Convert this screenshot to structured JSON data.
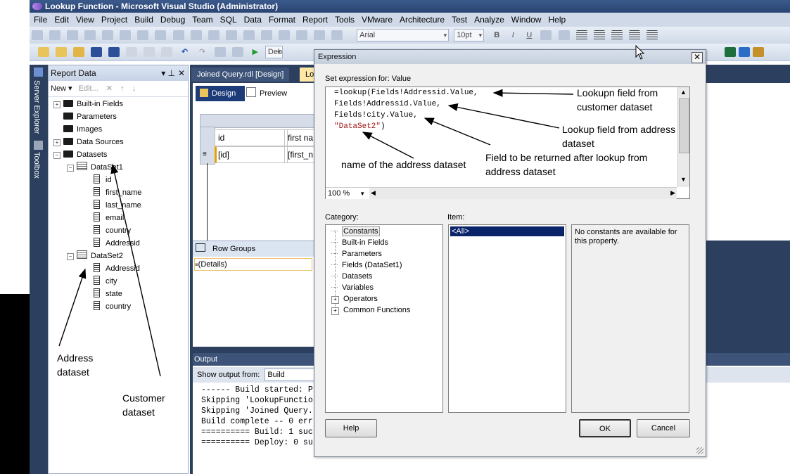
{
  "window": {
    "title": "Lookup Function - Microsoft Visual Studio (Administrator)"
  },
  "menu": [
    "File",
    "Edit",
    "View",
    "Project",
    "Build",
    "Debug",
    "Team",
    "SQL",
    "Data",
    "Format",
    "Report",
    "Tools",
    "VMware",
    "Architecture",
    "Test",
    "Analyze",
    "Window",
    "Help"
  ],
  "toolbar": {
    "font_name": "Arial",
    "font_size": "10pt",
    "config": "Deb"
  },
  "side_tabs": {
    "server_explorer": "Server Explorer",
    "toolbox": "Toolbox"
  },
  "report_data": {
    "title": "Report Data",
    "pin_glyph": "▾ ⊥",
    "close_glyph": "✕",
    "new_label": "New ▾",
    "edit_label": "Edit...",
    "tree": {
      "builtin": "Built-in Fields",
      "parameters": "Parameters",
      "images": "Images",
      "data_sources": "Data Sources",
      "datasets": "Datasets",
      "dataset1": "DataSet1",
      "dataset1_fields": [
        "id",
        "first_name",
        "last_name",
        "email",
        "country",
        "Addressid"
      ],
      "dataset2": "DataSet2",
      "dataset2_fields": [
        "Addressid",
        "city",
        "state",
        "country"
      ]
    }
  },
  "doc_tabs": {
    "tab1": "Joined Query.rdl [Design]",
    "tab2": "Loo"
  },
  "design": {
    "design_tab": "Design",
    "preview_tab": "Preview",
    "cell_header_1": "id",
    "cell_header_2": "first na",
    "cell_data_1": "[id]",
    "cell_data_2": "[first_n"
  },
  "row_groups": {
    "title": "Row Groups",
    "details": "(Details)"
  },
  "output": {
    "title": "Output",
    "show_from_label": "Show output from:",
    "show_from_value": "Build",
    "lines": [
      "------ Build started: P",
      "Skipping 'LookupFunctio",
      "Skipping 'Joined Query.",
      "Build complete -- 0 err",
      "========== Build: 1 suc",
      "========== Deploy: 0 su"
    ]
  },
  "dialog": {
    "title": "Expression",
    "set_for": "Set expression for: Value",
    "expression_lines": [
      "=lookup(Fields!Addressid.Value,",
      "Fields!Addressid.Value,",
      "Fields!city.Value,"
    ],
    "expression_string": "\"DataSet2\"",
    "expression_tail": ")",
    "zoom": "100 %",
    "category_label": "Category:",
    "categories": [
      "Constants",
      "Built-in Fields",
      "Parameters",
      "Fields (DataSet1)",
      "Datasets",
      "Variables",
      "Operators",
      "Common Functions"
    ],
    "item_label": "Item:",
    "item_selected": "<All>",
    "description": "No constants are available for this property.",
    "help_button": "Help",
    "ok_button": "OK",
    "cancel_button": "Cancel"
  },
  "annotations": {
    "lookup_customer": [
      "Lookupn field from",
      "customer dataset"
    ],
    "lookup_address": [
      "Lookup field from address",
      "dataset"
    ],
    "field_returned": [
      "Field to be returned after lookup from",
      "address dataset"
    ],
    "address_dataset_name": "name of the address dataset",
    "address_dataset": [
      "Address",
      "dataset"
    ],
    "customer_dataset": [
      "Customer",
      "dataset"
    ]
  },
  "colors": {
    "chrome_dark": "#2c3f5e",
    "selection": "#0a246a",
    "string_red": "#a31515"
  }
}
